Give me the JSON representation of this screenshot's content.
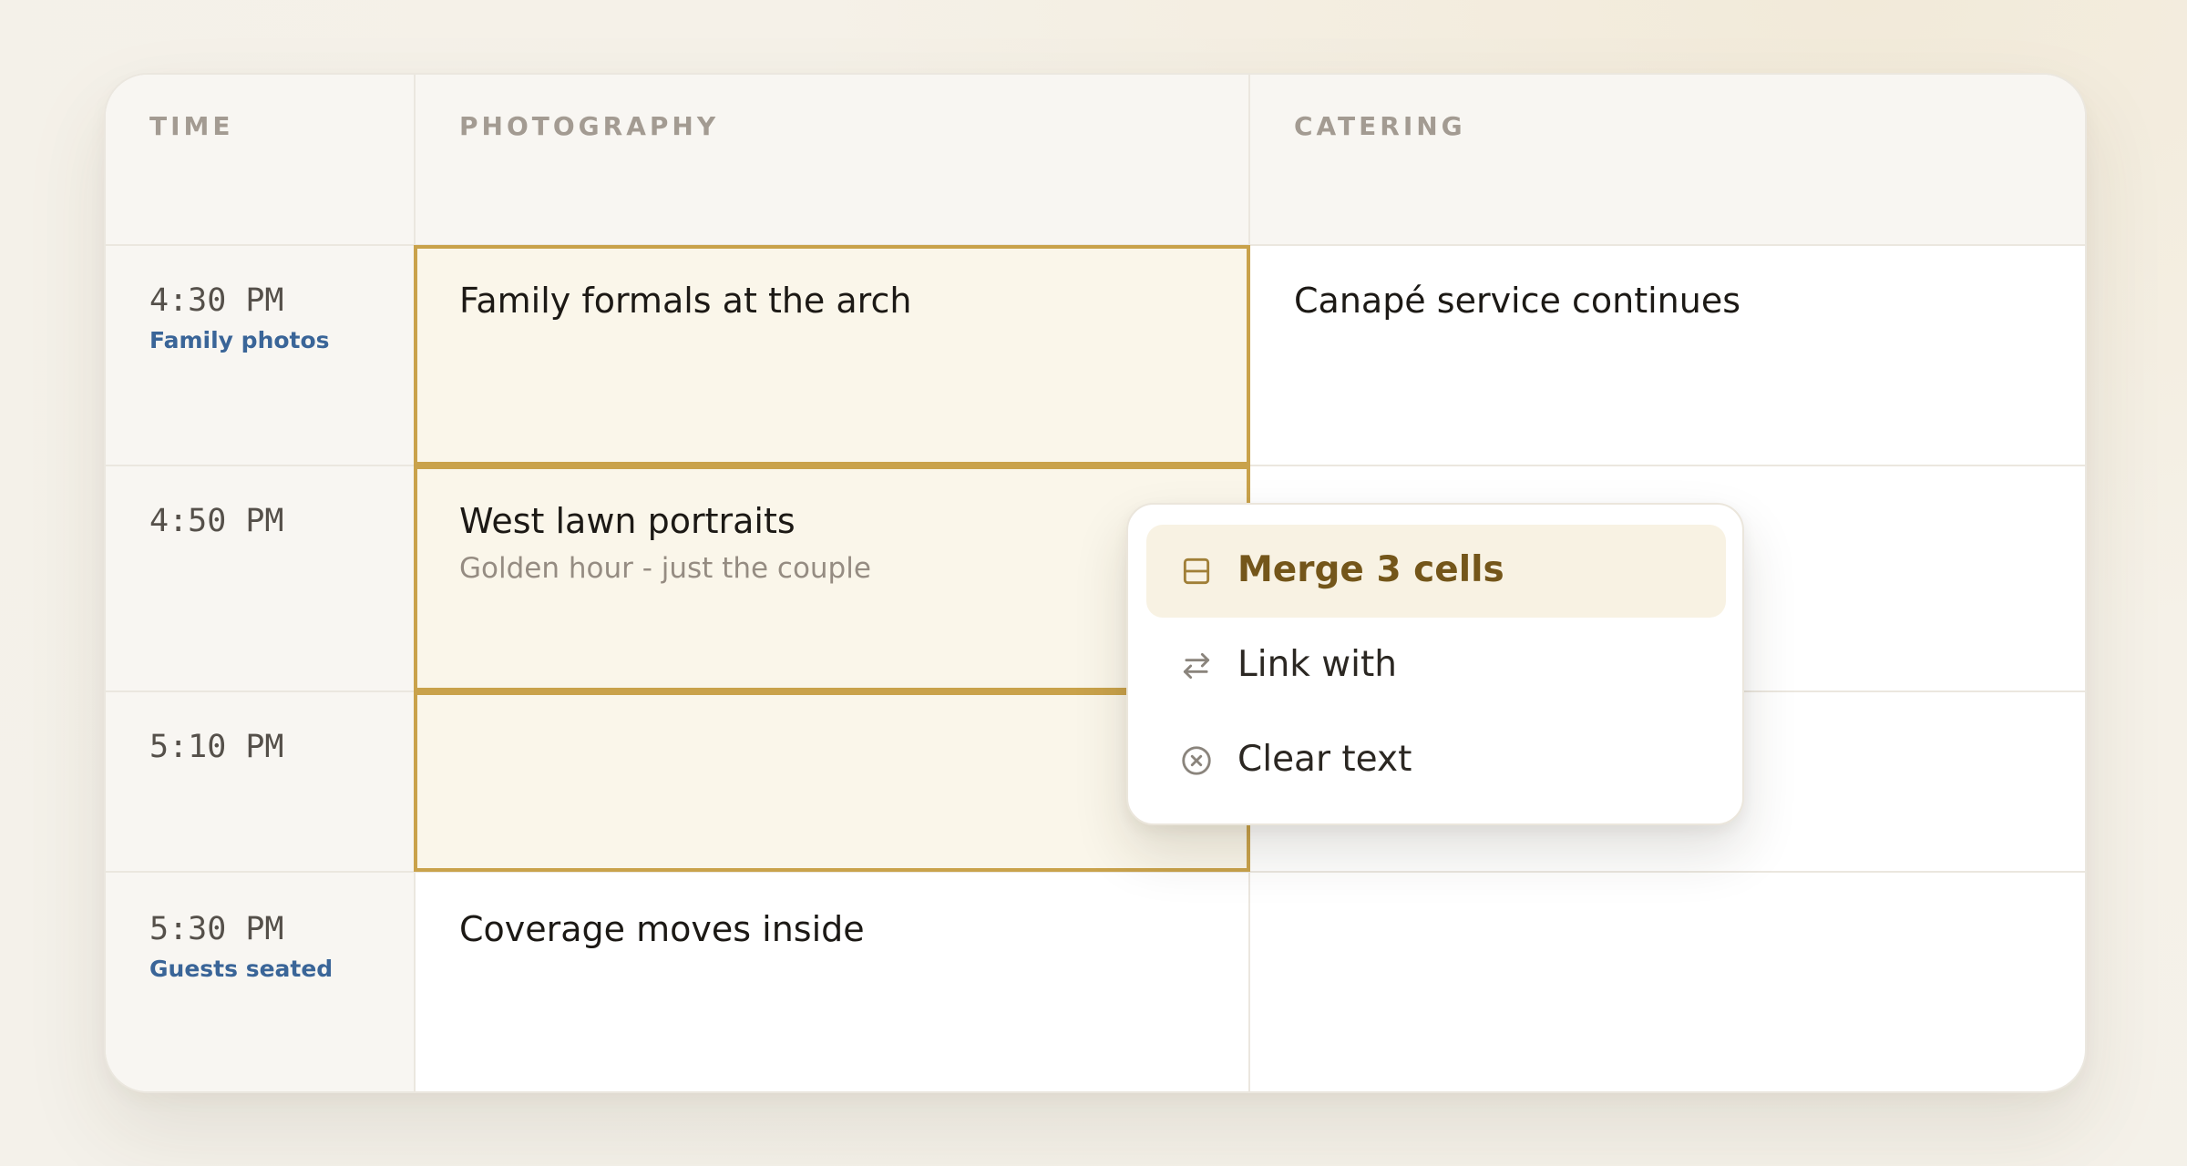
{
  "columns": {
    "time": "TIME",
    "photography": "PHOTOGRAPHY",
    "catering": "CATERING"
  },
  "rows": [
    {
      "time": "4:30 PM",
      "time_label": "Family photos",
      "photography_title": "Family formals at the arch",
      "catering_title": "Canapé service continues"
    },
    {
      "time": "4:50 PM",
      "photography_title": "West lawn portraits",
      "photography_subtitle": "Golden hour - just the couple"
    },
    {
      "time": "5:10 PM"
    },
    {
      "time": "5:30 PM",
      "time_label": "Guests seated",
      "photography_title": "Coverage moves inside"
    }
  ],
  "context_menu": {
    "items": [
      {
        "label": "Merge 3 cells",
        "icon": "merge-icon",
        "active": true
      },
      {
        "label": "Link with",
        "icon": "swap-arrows-icon",
        "active": false
      },
      {
        "label": "Clear text",
        "icon": "clear-circle-icon",
        "active": false
      }
    ]
  },
  "colors": {
    "selection_border": "#c9a24b",
    "selection_fill": "#faf6ea",
    "time_label": "#3a6598",
    "menu_active_text": "#74561a"
  }
}
